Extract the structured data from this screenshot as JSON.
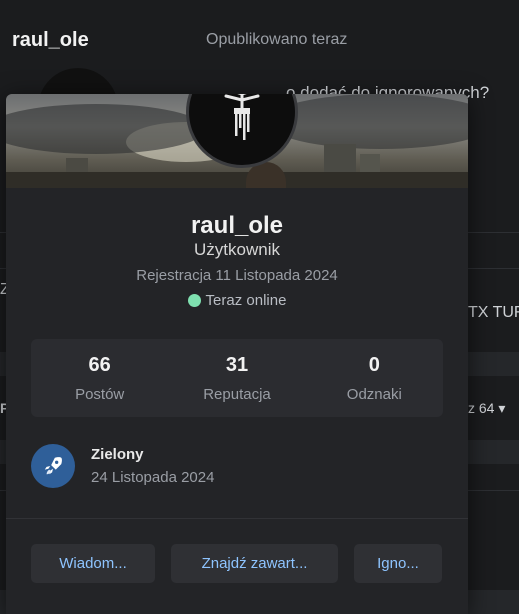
{
  "background": {
    "username": "raul_ole",
    "published": "Opublikowano teraz",
    "question": "o dodać do ignorowanych?",
    "side_left_1": "Z",
    "side_left_2": "P",
    "right_text": "TX TUF",
    "right_select": "z 64 ▾"
  },
  "profile": {
    "name": "raul_ole",
    "role": "Użytkownik",
    "registered": "Rejestracja 11 Listopada 2024",
    "online_status": "Teraz online",
    "online_color": "#7fe0b0"
  },
  "stats": [
    {
      "value": "66",
      "label": "Postów"
    },
    {
      "value": "31",
      "label": "Reputacja"
    },
    {
      "value": "0",
      "label": "Odznaki"
    }
  ],
  "badge": {
    "name": "Zielony",
    "date": "24 Listopada 2024",
    "icon": "rocket-icon",
    "color": "#2f5f99"
  },
  "actions": {
    "message": "Wiadom...",
    "find_content": "Znajdź zawart...",
    "ignore": "Igno..."
  },
  "colors": {
    "accent_link": "#8ec4ff",
    "card_bg": "#232427"
  }
}
